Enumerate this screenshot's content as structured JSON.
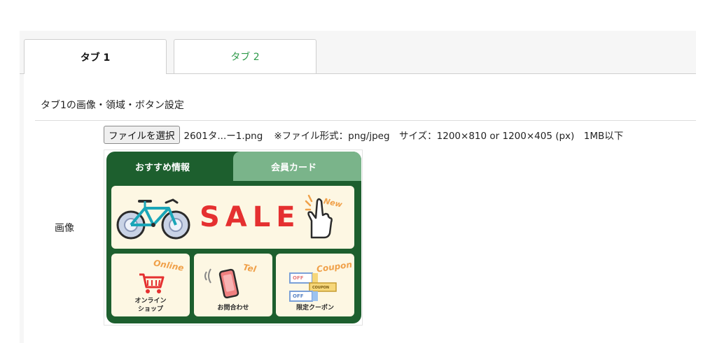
{
  "tabs": [
    {
      "label": "タブ 1",
      "active": true
    },
    {
      "label": "タブ 2",
      "active": false
    }
  ],
  "section": {
    "title": "タブ1の画像・領域・ボタン設定"
  },
  "image_row": {
    "label": "画像",
    "file_button": "ファイルを選択",
    "file_name": "2601タ...ー1.png",
    "note": "※ファイル形式：png/jpeg　サイズ：1200×810 or 1200×405 (px)　1MB以下"
  },
  "preview": {
    "tab_left": "おすすめ情報",
    "tab_right": "会員カード",
    "sale": "SALE",
    "new_tag": "New",
    "cards": [
      {
        "accent": "Online",
        "label": "オンライン\nショップ"
      },
      {
        "accent": "Tel",
        "label": "お問合わせ"
      },
      {
        "accent": "Coupon",
        "label": "限定クーポン"
      }
    ],
    "coupon_off": "OFF",
    "coupon_word": "COUPON"
  },
  "colors": {
    "accent_green": "#2e9a4a",
    "dark_green": "#1d5f2e",
    "light_green": "#7ab48a",
    "sale_red": "#e53030",
    "cream": "#fdf7e3"
  }
}
